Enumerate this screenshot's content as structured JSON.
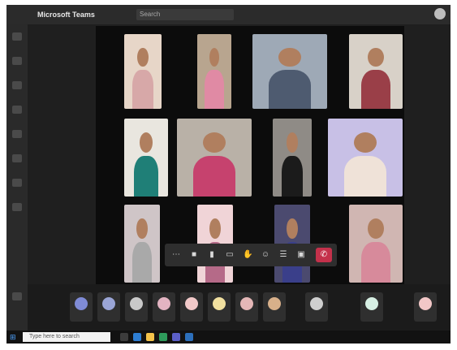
{
  "window": {
    "title": "Microsoft Teams",
    "search_placeholder": "Search"
  },
  "rail": {
    "count": 9
  },
  "gallery": {
    "tiles": [
      {
        "name": "",
        "bg": "#e7d6c8",
        "body": "#d7a8a8"
      },
      {
        "name": "",
        "bg": "#b8a58f",
        "body": "#e08aa4"
      },
      {
        "name": "",
        "bg": "#9ea9b6",
        "body": "#4e5b70"
      },
      {
        "name": "",
        "bg": "#d8d1c8",
        "body": "#9a3f48"
      },
      {
        "name": "",
        "bg": "#e9e6df",
        "body": "#1f7f77"
      },
      {
        "name": "",
        "bg": "#b9b1a7",
        "body": "#c6426e"
      },
      {
        "name": "",
        "bg": "#8f8b86",
        "body": "#1b1b1b"
      },
      {
        "name": "",
        "bg": "#c8c0e6",
        "body": "#efe2d8"
      },
      {
        "name": "",
        "bg": "#cfc5c7",
        "body": "#a9a9a9"
      },
      {
        "name": "",
        "bg": "#f0d4d7",
        "body": "#b56a88"
      },
      {
        "name": "",
        "bg": "#4b4a6f",
        "body": "#3a3f8a"
      },
      {
        "name": "",
        "bg": "#d0b6b2",
        "body": "#d78a9b"
      }
    ]
  },
  "controls": {
    "icons": [
      "more",
      "video",
      "mic",
      "share",
      "raise",
      "react",
      "participants",
      "leave"
    ],
    "hangup_label": "✆"
  },
  "strip": {
    "participants": [
      {
        "initials": "",
        "color": "#7f8bd6"
      },
      {
        "initials": "",
        "color": "#9aa5d6"
      },
      {
        "initials": "",
        "color": "#c9c9c9"
      },
      {
        "initials": "",
        "color": "#e3b4c2"
      },
      {
        "initials": "",
        "color": "#f2c9c9"
      },
      {
        "initials": "",
        "color": "#f1e0a0"
      },
      {
        "initials": "",
        "color": "#e4b7b7"
      },
      {
        "initials": "",
        "color": "#d8b08a"
      }
    ],
    "labeled": [
      {
        "label": "",
        "color": "#cfcfcf"
      },
      {
        "label": "",
        "color": "#d6efe3"
      },
      {
        "label": "",
        "color": "#f2c7c7"
      }
    ]
  },
  "taskbar": {
    "search_placeholder": "Type here to search",
    "time": "",
    "date": ""
  }
}
